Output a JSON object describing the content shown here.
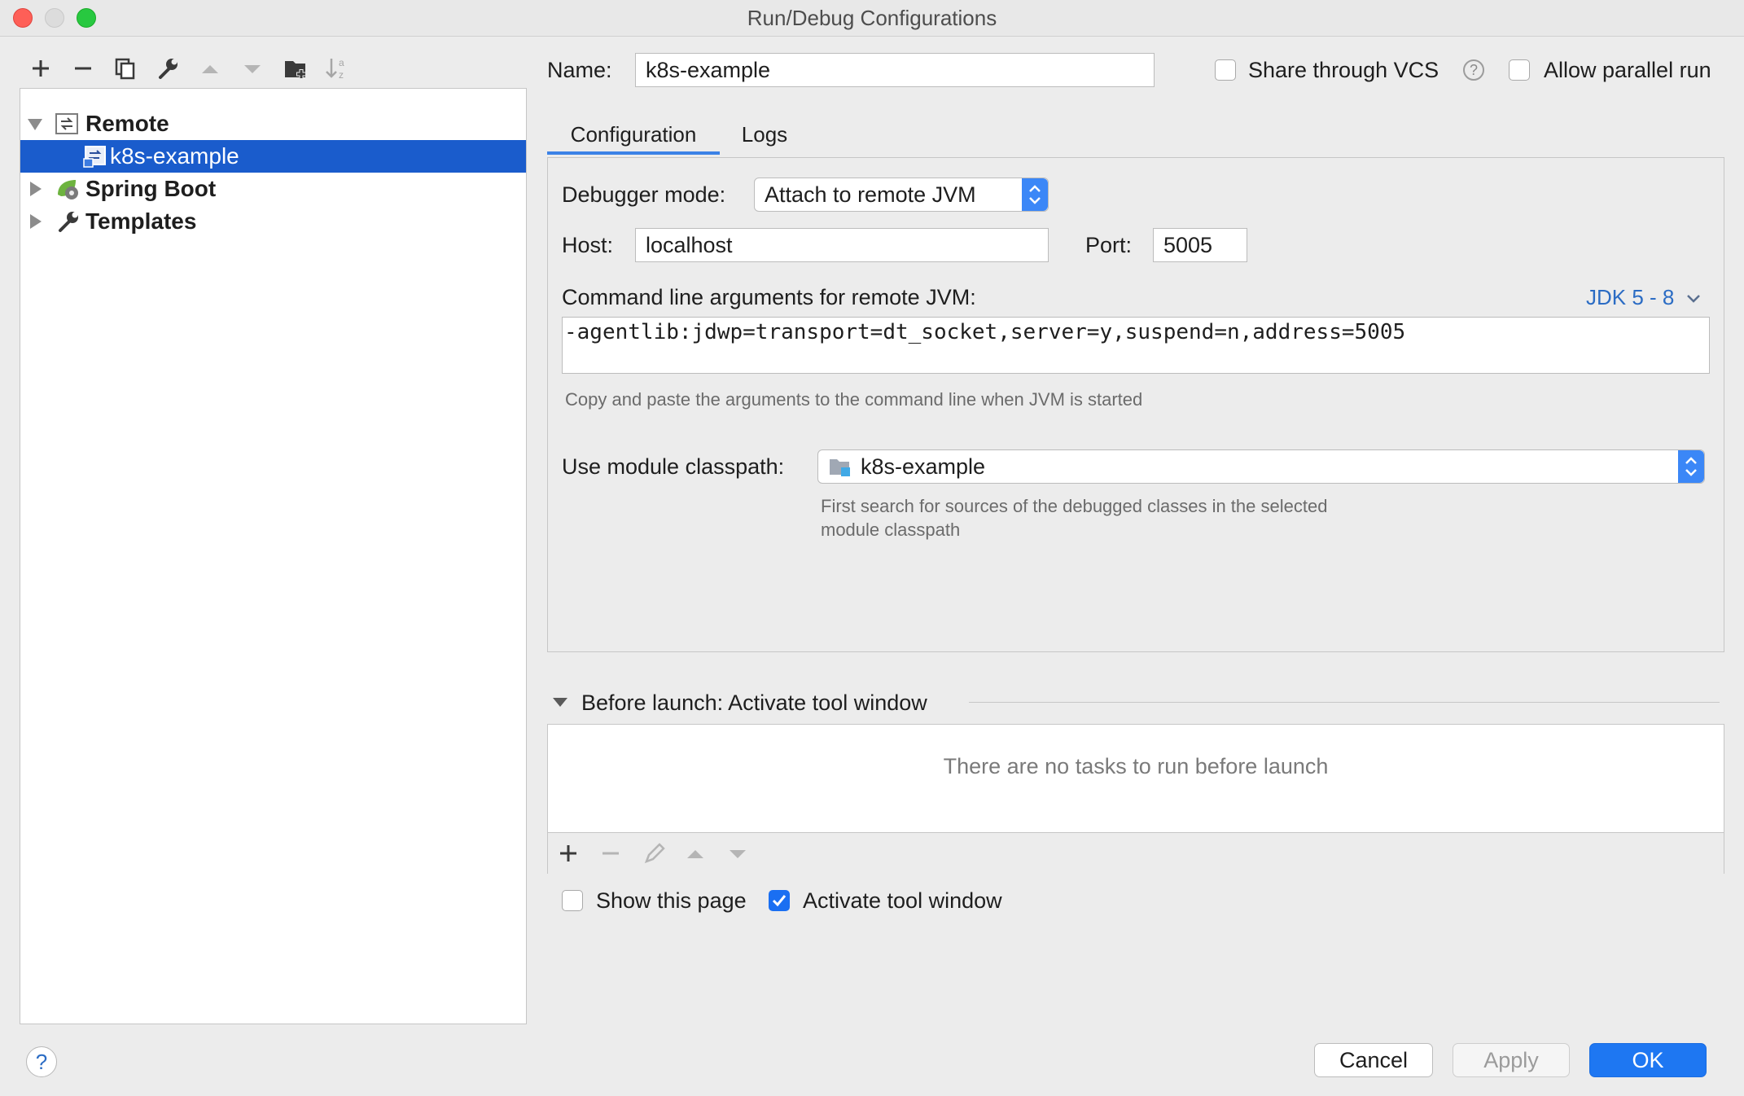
{
  "window": {
    "title": "Run/Debug Configurations"
  },
  "tree": {
    "items": [
      {
        "label": "Remote",
        "bold": true,
        "expanded": true,
        "icon": "remote-icon"
      },
      {
        "label": "k8s-example",
        "selected": true,
        "icon": "remote-config-icon"
      },
      {
        "label": "Spring Boot",
        "bold": true,
        "expanded": false,
        "icon": "spring-boot-icon"
      },
      {
        "label": "Templates",
        "bold": true,
        "expanded": false,
        "icon": "wrench-icon"
      }
    ]
  },
  "header": {
    "name_label": "Name:",
    "name_value": "k8s-example",
    "share_vcs_label": "Share through VCS",
    "share_vcs_checked": false,
    "parallel_label": "Allow parallel run",
    "parallel_checked": false
  },
  "tabs": [
    {
      "label": "Configuration",
      "active": true
    },
    {
      "label": "Logs",
      "active": false
    }
  ],
  "config": {
    "debugger_mode_label": "Debugger mode:",
    "debugger_mode_value": "Attach to remote JVM",
    "host_label": "Host:",
    "host_value": "localhost",
    "port_label": "Port:",
    "port_value": "5005",
    "cmd_label": "Command line arguments for remote JVM:",
    "jdk_link": "JDK 5 - 8",
    "cmd_value": "-agentlib:jdwp=transport=dt_socket,server=y,suspend=n,address=5005",
    "cmd_hint": "Copy and paste the arguments to the command line when JVM is started",
    "classpath_label": "Use module classpath:",
    "classpath_value": "k8s-example",
    "classpath_hint_1": "First search for sources of the debugged classes in the selected",
    "classpath_hint_2": "module classpath"
  },
  "before_launch": {
    "title": "Before launch: Activate tool window",
    "empty_text": "There are no tasks to run before launch",
    "show_page_label": "Show this page",
    "show_page_checked": false,
    "activate_label": "Activate tool window",
    "activate_checked": true
  },
  "footer": {
    "cancel": "Cancel",
    "apply": "Apply",
    "ok": "OK",
    "help": "?"
  },
  "colors": {
    "selection": "#1a5ccc",
    "accent": "#1e77f2",
    "link": "#2b6cc4",
    "close": "#fe5f57",
    "minimize": "#dcdcdc",
    "zoom": "#28c840"
  }
}
